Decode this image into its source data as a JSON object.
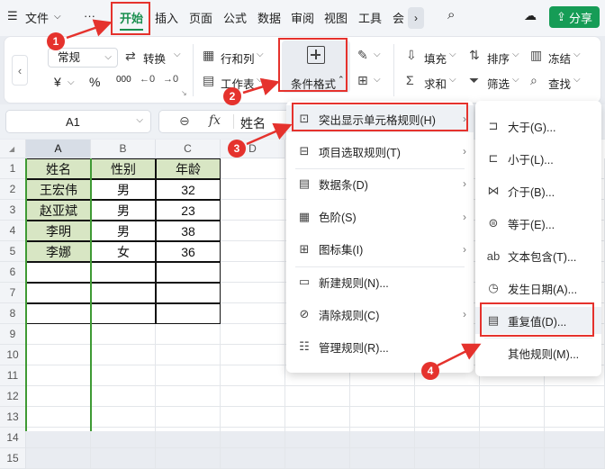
{
  "menubar": {
    "file_label": "文件",
    "more_label": "···",
    "tabs": [
      "开始",
      "插入",
      "页面",
      "公式",
      "数据",
      "审阅",
      "视图",
      "工具",
      "会"
    ],
    "share_label": "分享"
  },
  "ribbon": {
    "number_format": "常规",
    "convert_label": "转换",
    "row_col_label": "行和列",
    "sheet_label": "工作表",
    "cond_format_label": "条件格式",
    "fill_label": "填充",
    "sort_label": "排序",
    "freeze_label": "冻结",
    "sum_label": "求和",
    "filter_label": "筛选",
    "find_label": "查找",
    "yen_symbol": "¥",
    "percent_symbol": "%",
    "thousands_symbol": "000"
  },
  "formula_bar": {
    "cell_ref": "A1",
    "fx_label": "fx",
    "content": "姓名"
  },
  "sheet": {
    "columns": [
      "A",
      "B",
      "C",
      "D"
    ],
    "rows": [
      "1",
      "2",
      "3",
      "4",
      "5",
      "6",
      "7",
      "8",
      "9",
      "10",
      "11",
      "12",
      "13",
      "14",
      "15"
    ],
    "table": [
      [
        "姓名",
        "性别",
        "年龄"
      ],
      [
        "王宏伟",
        "男",
        "32"
      ],
      [
        "赵亚斌",
        "男",
        "23"
      ],
      [
        "李明",
        "男",
        "38"
      ],
      [
        "李娜",
        "女",
        "36"
      ]
    ]
  },
  "cond_menu": {
    "items": [
      {
        "label": "突出显示单元格规则(H)",
        "icon": "highlight-rules-icon"
      },
      {
        "label": "项目选取规则(T)",
        "icon": "top-bottom-rules-icon"
      },
      {
        "label": "数据条(D)",
        "icon": "data-bar-icon"
      },
      {
        "label": "色阶(S)",
        "icon": "color-scale-icon"
      },
      {
        "label": "图标集(I)",
        "icon": "icon-set-icon"
      },
      {
        "label": "新建规则(N)...",
        "icon": "new-rule-icon"
      },
      {
        "label": "清除规则(C)",
        "icon": "clear-rule-icon"
      },
      {
        "label": "管理规则(R)...",
        "icon": "manage-rule-icon"
      }
    ]
  },
  "sub_menu": {
    "items": [
      {
        "label": "大于(G)...",
        "icon": "greater-than-icon"
      },
      {
        "label": "小于(L)...",
        "icon": "less-than-icon"
      },
      {
        "label": "介于(B)...",
        "icon": "between-icon"
      },
      {
        "label": "等于(E)...",
        "icon": "equal-icon"
      },
      {
        "label": "文本包含(T)...",
        "icon": "text-contains-icon"
      },
      {
        "label": "发生日期(A)...",
        "icon": "date-occurring-icon"
      },
      {
        "label": "重复值(D)...",
        "icon": "duplicate-values-icon"
      },
      {
        "label": "其他规则(M)...",
        "icon": ""
      }
    ]
  },
  "annotations": [
    "1",
    "2",
    "3",
    "4"
  ],
  "colors": {
    "accent_red": "#e5322d",
    "green": "#169c56",
    "header_fill": "#d8e6c4"
  }
}
